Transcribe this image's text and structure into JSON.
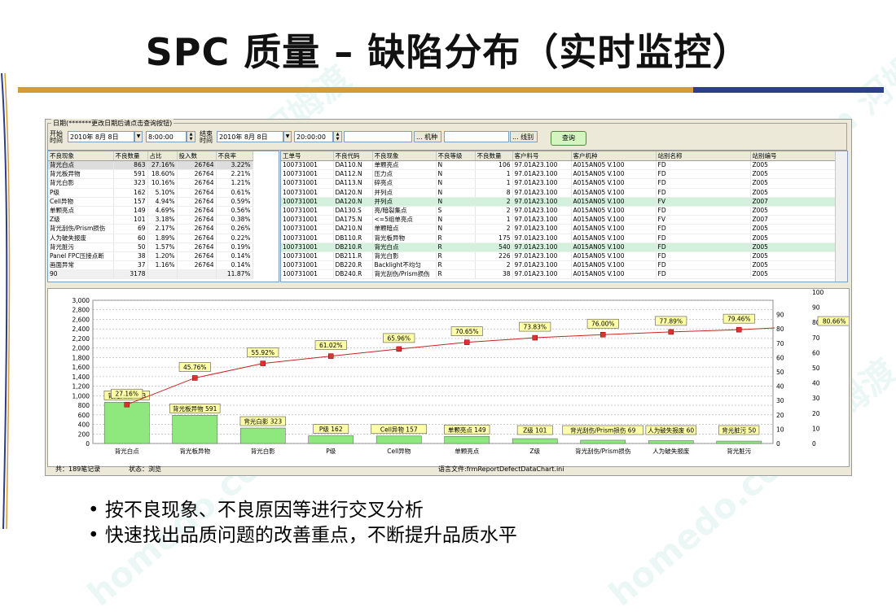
{
  "slide": {
    "title": "SPC 质量 – 缺陷分布（实时监控）",
    "bullets": [
      "按不良现象、不良原因等进行交叉分析",
      "快速找出品质问题的改善重点，不断提升品质水平"
    ],
    "watermark_text": "homedo.com 河姆渡"
  },
  "filter": {
    "legend": "日期(*******更改日期后请点击查询按钮)",
    "start_label": "开始时间",
    "start_date": "2010年 8月 8日",
    "start_time": "8:00:00",
    "end_label": "结束时间",
    "end_date": "2010年 8月 8日",
    "end_time": "20:00:00",
    "machine_btn": "... 机种",
    "group_btn": "... 线别",
    "query_btn": "查询"
  },
  "left_grid": {
    "columns": [
      "不良现象",
      "不良数量",
      "占比",
      "投入数",
      "不良率"
    ],
    "rows": [
      [
        "背光白点",
        "863",
        "27.16%",
        "26764",
        "3.22%"
      ],
      [
        "背光板异物",
        "591",
        "18.60%",
        "26764",
        "2.21%"
      ],
      [
        "背光白影",
        "323",
        "10.16%",
        "26764",
        "1.21%"
      ],
      [
        "P级",
        "162",
        "5.10%",
        "26764",
        "0.61%"
      ],
      [
        "Cell异物",
        "157",
        "4.94%",
        "26764",
        "0.59%"
      ],
      [
        "单颗亮点",
        "149",
        "4.69%",
        "26764",
        "0.56%"
      ],
      [
        "Z级",
        "101",
        "3.18%",
        "26764",
        "0.38%"
      ],
      [
        "背光刮伤/Prism损伤",
        "69",
        "2.17%",
        "26764",
        "0.26%"
      ],
      [
        "人为破失报废",
        "60",
        "1.89%",
        "26764",
        "0.22%"
      ],
      [
        "背光脏污",
        "50",
        "1.57%",
        "26764",
        "0.19%"
      ],
      [
        "Panel FPC压接点断",
        "38",
        "1.20%",
        "26764",
        "0.14%"
      ],
      [
        "画面异常",
        "37",
        "1.16%",
        "26764",
        "0.14%"
      ]
    ],
    "summary": [
      "90",
      "3178",
      "",
      "",
      "11.87%"
    ]
  },
  "right_grid": {
    "columns": [
      "工单号",
      "不良代码",
      "不良现象",
      "不良等级",
      "不良数量",
      "客户料号",
      "客户机种",
      "站别名称",
      "站别编号"
    ],
    "rows": [
      [
        "100731001",
        "DA110.N",
        "单颗亮点",
        "N",
        "106",
        "97.01A23.100",
        "A015AN05 V.100",
        "FD",
        "Z005"
      ],
      [
        "100731001",
        "DA112.N",
        "压力点",
        "N",
        "1",
        "97.01A23.100",
        "A015AN05 V.100",
        "FD",
        "Z005"
      ],
      [
        "100731001",
        "DA113.N",
        "碎亮点",
        "N",
        "1",
        "97.01A23.100",
        "A015AN05 V.100",
        "FD",
        "Z005"
      ],
      [
        "100731001",
        "DA120.N",
        "并列点",
        "N",
        "8",
        "97.01A23.100",
        "A015AN05 V.100",
        "FD",
        "Z005"
      ],
      [
        "100731001",
        "DA120.N",
        "并列点",
        "N",
        "2",
        "97.01A23.100",
        "A015AN05 V.100",
        "FV",
        "Z007"
      ],
      [
        "100731001",
        "DA130.S",
        "亮/暗裂集点",
        "S",
        "2",
        "97.01A23.100",
        "A015AN05 V.100",
        "FD",
        "Z005"
      ],
      [
        "100731001",
        "DA175.N",
        "<=5组单亮点",
        "N",
        "1",
        "97.01A23.100",
        "A015AN05 V.100",
        "FV",
        "Z007"
      ],
      [
        "100731001",
        "DA210.N",
        "单颗暗点",
        "N",
        "2",
        "97.01A23.100",
        "A015AN05 V.100",
        "FD",
        "Z005"
      ],
      [
        "100731001",
        "DB110.R",
        "背光板异物",
        "R",
        "175",
        "97.01A23.100",
        "A015AN05 V.100",
        "FD",
        "Z005"
      ],
      [
        "100731001",
        "DB210.R",
        "背光白点",
        "R",
        "540",
        "97.01A23.100",
        "A015AN05 V.100",
        "FD",
        "Z005"
      ],
      [
        "100731001",
        "DB211.R",
        "背光白影",
        "R",
        "226",
        "97.01A23.100",
        "A015AN05 V.100",
        "FD",
        "Z005"
      ],
      [
        "100731001",
        "DB220.R",
        "Backlight不均匀",
        "R",
        "2",
        "97.01A23.100",
        "A015AN05 V.100",
        "FD",
        "Z005"
      ],
      [
        "100731001",
        "DB240.R",
        "背光刮伤/Prism损伤",
        "R",
        "38",
        "97.01A23.100",
        "A015AN05 V.100",
        "FD",
        "Z005"
      ]
    ]
  },
  "chart_data": {
    "type": "bar",
    "categories": [
      "背光白点",
      "背光板异物",
      "背光白影",
      "P级",
      "Cell异物",
      "单颗亮点",
      "Z级",
      "背光刮伤/Prism损伤",
      "人为破失报废",
      "背光脏污"
    ],
    "series": [
      {
        "values": [
          863,
          591,
          323,
          162,
          157,
          149,
          101,
          69,
          60,
          50
        ]
      },
      {
        "values": [
          27.16,
          45.76,
          55.92,
          61.02,
          65.96,
          70.65,
          73.83,
          76.0,
          77.89,
          79.46
        ]
      }
    ],
    "bar_labels": [
      "背光白点 863",
      "背光板异物 591",
      "背光白影 323",
      "P级 162",
      "Cell异物 157",
      "单颗亮点 149",
      "Z级 101",
      "背光刮伤/Prism损伤 69",
      "人为破失报废 60",
      "背光脏污 50"
    ],
    "line_labels": [
      "27.16%",
      "45.76%",
      "55.92%",
      "61.02%",
      "65.96%",
      "70.65%",
      "73.83%",
      "76.00%",
      "77.89%",
      "79.46%"
    ],
    "end_label": "80.66%",
    "end_value": 80.66,
    "y_left_ticks": [
      "3,000",
      "2,800",
      "2,600",
      "2,400",
      "2,200",
      "2,000",
      "1,800",
      "1,600",
      "1,400",
      "1,200",
      "1,000",
      "800",
      "600",
      "400",
      "200",
      "0"
    ],
    "y_left_range": [
      0,
      3000
    ],
    "y_mid_ticks": [
      "90",
      "80",
      "70",
      "60",
      "50",
      "40",
      "30",
      "20",
      "10",
      "0"
    ],
    "y_right_ticks": [
      "100",
      "90",
      "80",
      "70",
      "60",
      "50",
      "40",
      "30",
      "20",
      "10",
      "0"
    ],
    "y_right_range": [
      0,
      100
    ],
    "grid": true,
    "colors": {
      "bar": "#8ee87e",
      "line": "#cc2222",
      "marker": "#e03030",
      "label_bg": "#ffffa8"
    }
  },
  "status": {
    "count": "共：189笔记录",
    "state": "状态：浏览",
    "lang": "语言文件:frmReportDefectDataChart.ini"
  }
}
